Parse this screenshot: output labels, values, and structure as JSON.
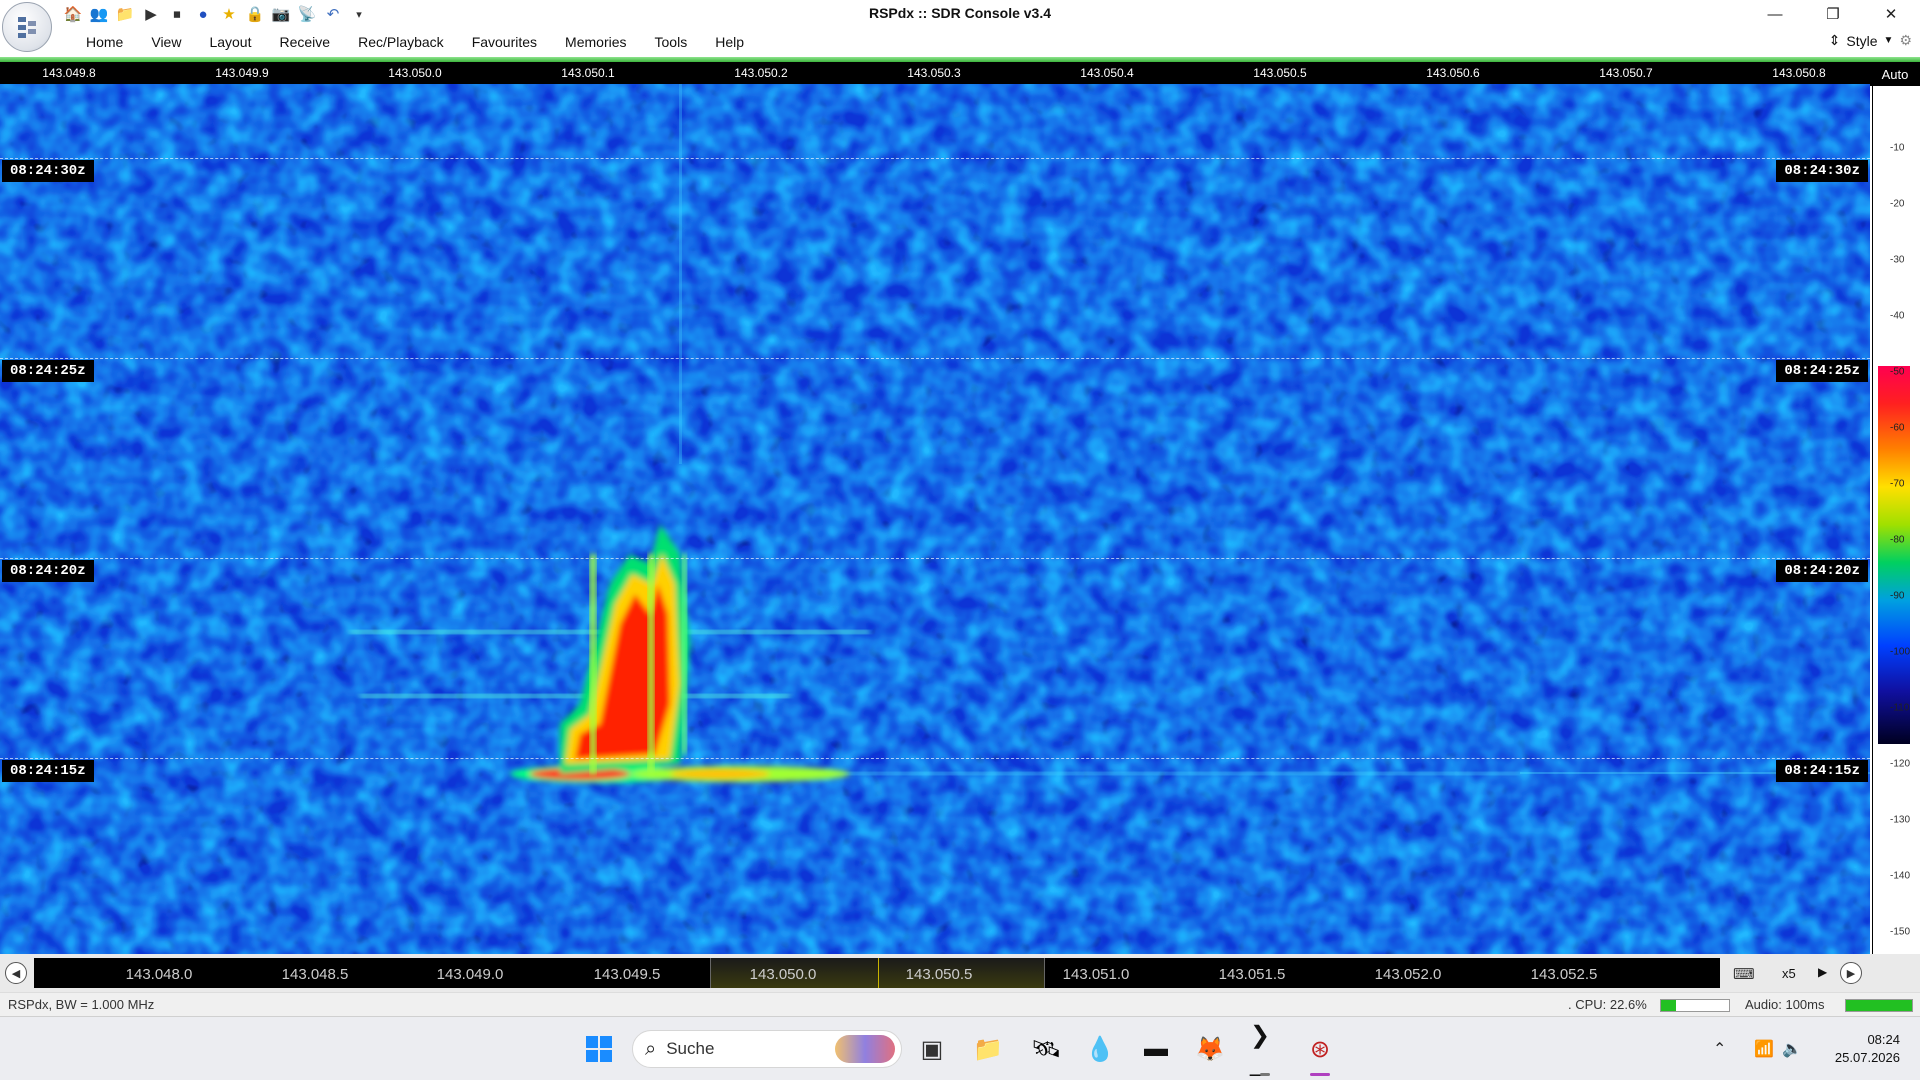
{
  "window": {
    "title": "RSPdx :: SDR Console v3.4",
    "quick_access_icons": [
      "home-icon",
      "users-icon",
      "folder-icon",
      "play-icon",
      "stop-icon",
      "record-icon",
      "star-icon",
      "lock-icon",
      "camera-icon",
      "satellite-icon",
      "undo-icon",
      "dropdown-icon"
    ],
    "controls": [
      "minimize",
      "restore",
      "close"
    ]
  },
  "menu": {
    "items": [
      "Home",
      "View",
      "Layout",
      "Receive",
      "Rec/Playback",
      "Favourites",
      "Memories",
      "Tools",
      "Help"
    ],
    "style_label": "Style"
  },
  "top_scale": {
    "ticks": [
      "143.049.8",
      "143.049.9",
      "143.050.0",
      "143.050.1",
      "143.050.2",
      "143.050.3",
      "143.050.4",
      "143.050.5",
      "143.050.6",
      "143.050.7",
      "143.050.8"
    ],
    "auto_label": "Auto"
  },
  "waterfall": {
    "time_labels": [
      "08:24:30z",
      "08:24:25z",
      "08:24:20z",
      "08:24:15z"
    ]
  },
  "db_scale": {
    "labels": [
      "-10",
      "-20",
      "-30",
      "-40",
      "-50",
      "-60",
      "-70",
      "-80",
      "-90",
      "-100",
      "-110",
      "-120",
      "-130",
      "-140",
      "-150"
    ]
  },
  "bottom_scale": {
    "ticks": [
      "143.048.0",
      "143.048.5",
      "143.049.0",
      "143.049.5",
      "143.050.0",
      "143.050.5",
      "143.051.0",
      "143.051.5",
      "143.052.0",
      "143.052.5"
    ],
    "zoom_label": "x5"
  },
  "status": {
    "left": "RSPdx, BW = 1.000 MHz",
    "cpu": ". CPU: 22.6%",
    "cpu_level": 0.226,
    "audio": "Audio: 100ms"
  },
  "taskbar": {
    "search_placeholder": "Suche",
    "time": "08:24",
    "date": "25.07.2026"
  }
}
